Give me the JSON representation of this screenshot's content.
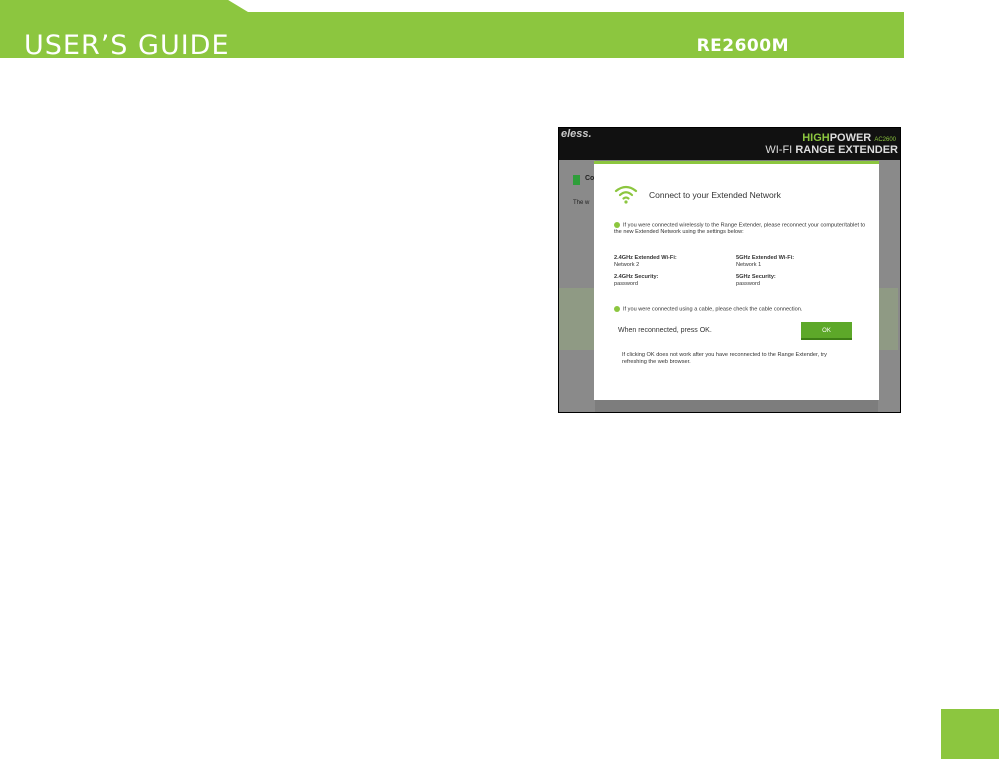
{
  "header": {
    "title": "USER’S GUIDE",
    "model": "RE2600M",
    "accent": "#8cc63f"
  },
  "screenshot": {
    "brand_left": "eless.",
    "brand_line1_hi": "HIGH",
    "brand_line1_rest": "POWER",
    "brand_line1_sub": "AC2600",
    "brand_line2_pre": "WI-FI",
    "brand_line2_bold": "RANGE EXTENDER",
    "side_heading": "Co",
    "side_text": "The w",
    "modal": {
      "title": "Connect to your Extended Network",
      "wireless_msg": "If you were connected wirelessly to the Range Extender, please reconnect your computer/tablet to the new Extended Network using the settings below:",
      "wifi24_label": "2.4GHz Extended Wi-Fi:",
      "wifi24_value": "Network 2",
      "sec24_label": "2.4GHz Security:",
      "sec24_value": "password",
      "wifi5_label": "5GHz Extended Wi-Fi:",
      "wifi5_value": "Network 1",
      "sec5_label": "5GHz Security:",
      "sec5_value": "password",
      "cable_msg": "If you were connected using a cable, please check the cable connection.",
      "reconnect_text": "When reconnected, press OK.",
      "ok_label": "OK",
      "tip": "If clicking OK does not work after you have reconnected to the Range Extender, try refreshing the web browser."
    }
  }
}
